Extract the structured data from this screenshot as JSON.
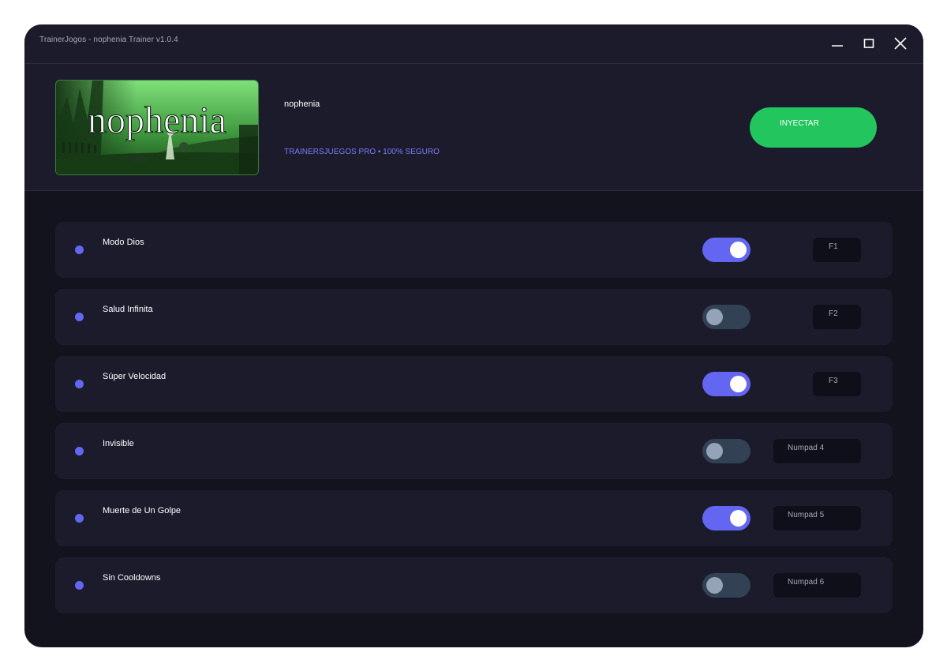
{
  "window": {
    "title": "TrainerJogos - nophenia Trainer v1.0.4",
    "controls": [
      "minimize-icon",
      "maximize-icon",
      "close-icon"
    ]
  },
  "header": {
    "game_logo_text": "nophenia",
    "game_name": "nophenia",
    "tagline": "TRAINERSJUEGOS PRO • 100% SEGURO",
    "inject_label": "INYECTAR"
  },
  "colors": {
    "accent": "#6366f1",
    "inject": "#22c55e",
    "background": "#13131e",
    "panel": "#1b1b2c"
  },
  "cheats": [
    {
      "name": "Modo Dios",
      "enabled": true,
      "hotkey": "F1"
    },
    {
      "name": "Salud Infinita",
      "enabled": false,
      "hotkey": "F2"
    },
    {
      "name": "Súper Velocidad",
      "enabled": true,
      "hotkey": "F3"
    },
    {
      "name": "Invisible",
      "enabled": false,
      "hotkey": "Numpad 4"
    },
    {
      "name": "Muerte de Un Golpe",
      "enabled": true,
      "hotkey": "Numpad 5"
    },
    {
      "name": "Sin Cooldowns",
      "enabled": false,
      "hotkey": "Numpad 6"
    }
  ]
}
